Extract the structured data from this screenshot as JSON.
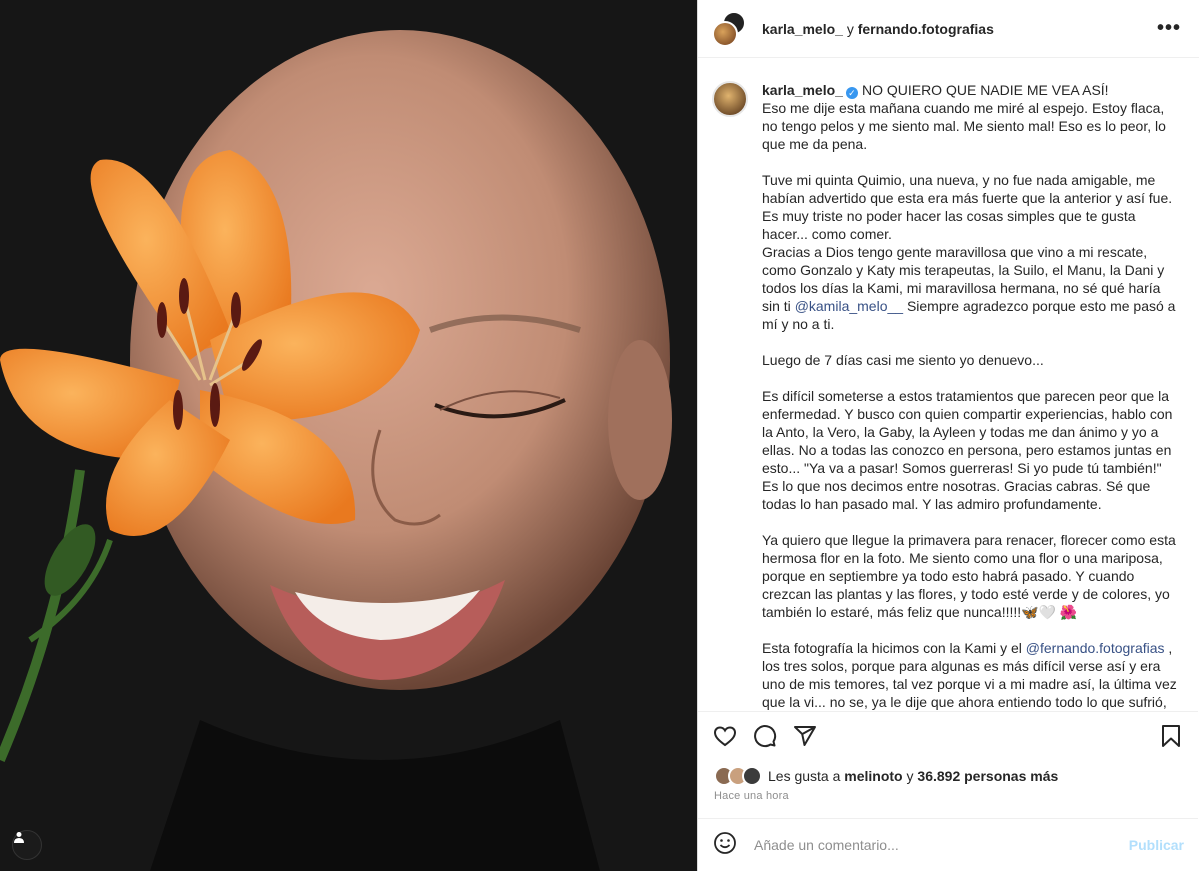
{
  "post": {
    "author": "karla_melo_",
    "conjunction": "y",
    "coauthor": "fernando.fotografias",
    "more_label": "•••"
  },
  "caption": {
    "username": "karla_melo_",
    "verified_icon": "verified-badge-icon",
    "p1": "NO QUIERO QUE NADIE ME VEA ASÍ!\nEso me dije esta mañana cuando me miré al espejo. Estoy flaca, no tengo pelos y me siento mal. Me siento mal! Eso es lo peor, lo que me da pena.\n\nTuve mi quinta Quimio, una nueva, y no fue nada amigable, me habían advertido que esta era más fuerte que la anterior y así fue. Es muy triste no poder hacer las cosas simples que te gusta hacer... como comer.\nGracias a Dios tengo gente maravillosa que vino a mi rescate, como Gonzalo y Katy mis terapeutas, la Suilo, el Manu, la Dani y todos los días la Kami, mi maravillosa hermana, no sé qué haría sin ti ",
    "mention1": "@kamila_melo__",
    "p2": " Siempre agradezco porque esto me pasó a mí y no a ti.\n\nLuego de 7 días casi me siento yo denuevo...\n\nEs difícil someterse a estos tratamientos que parecen peor que la enfermedad. Y busco con quien compartir experiencias, hablo con la Anto, la Vero, la Gaby, la Ayleen y todas me dan ánimo y yo a ellas. No a todas las conozco en persona, pero estamos juntas en esto... \"Ya va a pasar! Somos guerreras! Si yo pude tú también!\" Es lo que nos decimos entre nosotras. Gracias cabras. Sé que todas lo han pasado mal. Y las admiro profundamente.\n\nYa quiero que llegue la primavera para renacer, florecer como esta hermosa flor en la foto. Me siento como una flor o una mariposa, porque en septiembre ya todo esto habrá pasado. Y cuando crezcan las plantas y las flores, y todo esté verde y de colores, yo también lo estaré, más feliz que nunca!!!!!🦋🤍 🌺\n\nEsta fotografía la hicimos con la Kami y el ",
    "mention2": "@fernando.fotografias",
    "p3": " , los tres solos, porque para algunas es más difícil verse así y era uno de mis temores, tal vez porque vi a mi madre así, la última vez que la vi... no se, ya le dije que ahora entiendo todo lo que sufrió, que la"
  },
  "likes": {
    "prefix": "Les gusta a",
    "user": "melinoto",
    "middle": "y",
    "count": "36.892 personas más"
  },
  "timestamp": "Hace una hora",
  "comment": {
    "placeholder": "Añade un comentario...",
    "publish_label": "Publicar"
  },
  "icons": {
    "like": "heart-icon",
    "comment": "comment-icon",
    "share": "share-icon",
    "save": "bookmark-icon",
    "emoji": "emoji-icon",
    "user_tag": "user-tag-icon"
  },
  "colors": {
    "mention": "#385185",
    "verified": "#3897f0",
    "publish_disabled": "#b2dffc",
    "lily": "#f4953a"
  }
}
